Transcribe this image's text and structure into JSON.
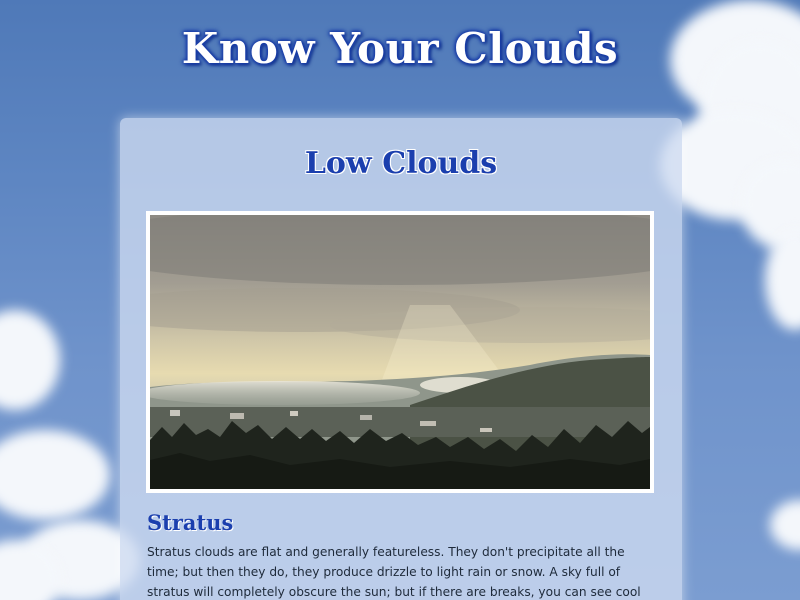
{
  "header": {
    "title": "Know Your Clouds"
  },
  "section": {
    "title": "Low Clouds",
    "photo_alt": "",
    "cloud_type": {
      "name": "Stratus",
      "description": "Stratus clouds are flat and generally featureless. They don't precipitate all the time; but then they do, they produce drizzle to light rain or snow. A sky full of stratus will completely obscure the sun; but if there are breaks, you can see cool stuff like this. (Those rays of sun"
    }
  },
  "colors": {
    "sky": "#5e86c2",
    "heading_blue": "#1b3fae",
    "panel": "#cedbf1"
  }
}
